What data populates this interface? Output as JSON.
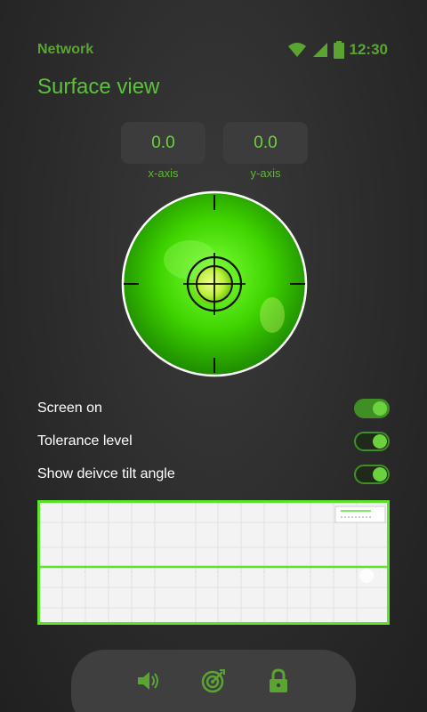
{
  "status_bar": {
    "carrier": "Network",
    "time": "12:30",
    "icons": [
      "wifi-icon",
      "signal-icon",
      "battery-icon"
    ]
  },
  "page": {
    "title": "Surface view"
  },
  "readouts": {
    "x": {
      "value": "0.0",
      "label": "x-axis"
    },
    "y": {
      "value": "0.0",
      "label": "y-axis"
    }
  },
  "settings": [
    {
      "label": "Screen on",
      "enabled": true
    },
    {
      "label": "Tolerance level",
      "enabled": true
    },
    {
      "label": "Show deivce tilt angle",
      "enabled": true
    }
  ],
  "bottom_bar": {
    "icons": [
      "speaker-icon",
      "target-icon",
      "lock-icon"
    ]
  },
  "colors": {
    "accent": "#5cc23a",
    "accent_bright": "#6bd13e",
    "bubble_green": "#3fd400",
    "chart_border": "#5be32d",
    "background": "#2b2b2b"
  }
}
